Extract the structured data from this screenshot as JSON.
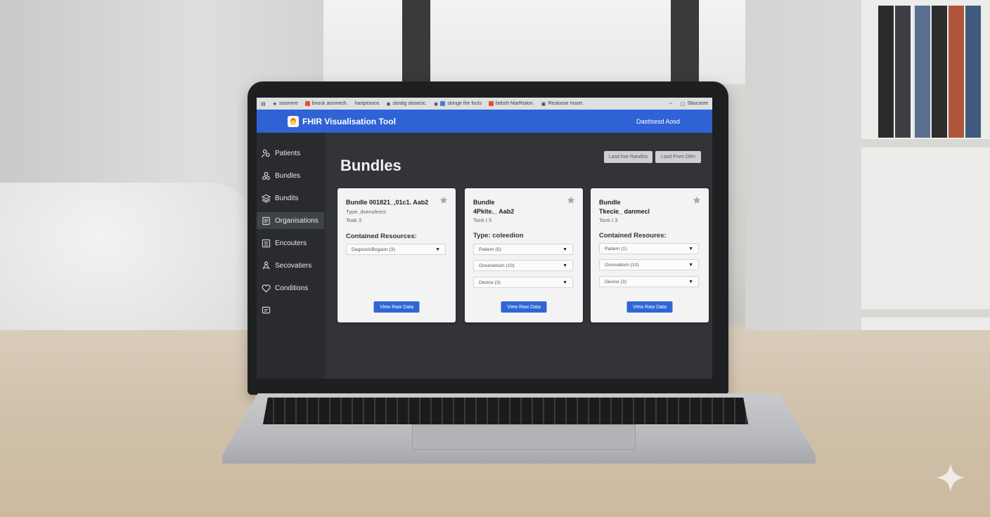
{
  "browser": {
    "tabs": [
      {
        "label": "sosmere",
        "color": "#777777"
      },
      {
        "label": "bnock aosmech.",
        "color": "#e0522b"
      },
      {
        "label": "hartpesoos",
        "color": "#dedfe1"
      },
      {
        "label": "slostig slosecic.",
        "color": "#555555"
      },
      {
        "label": "slonge the focls",
        "color": "#4a7bd8"
      },
      {
        "label": "bebsh MarRstion.",
        "color": "#e0522b"
      },
      {
        "label": "Resloose Insort.",
        "color": "#777777"
      }
    ],
    "right_label": "Sbocsnre"
  },
  "app": {
    "title": "FHIR Visualisation Tool",
    "header_link": "Dastlsesd  Aosd"
  },
  "sidebar": {
    "items": [
      {
        "label": "Patients",
        "icon": "people-icon"
      },
      {
        "label": "Bundles",
        "icon": "people-icon"
      },
      {
        "label": "Bundits",
        "icon": "layers-icon"
      },
      {
        "label": "Organisations",
        "icon": "document-icon",
        "active": true
      },
      {
        "label": "Encouters",
        "icon": "list-icon"
      },
      {
        "label": "Secovatiers",
        "icon": "network-icon"
      },
      {
        "label": "Conditions",
        "icon": "heart-icon"
      },
      {
        "label": "",
        "icon": "chat-icon"
      }
    ]
  },
  "main": {
    "title": "Bundles",
    "buttons": [
      "Lasd hse Randlss",
      "Lasd Fmm DRn"
    ],
    "cards": [
      {
        "title_lines": [
          "Bundle 001821_,01c1. Aab2"
        ],
        "type_text": "Type, dsensfeect",
        "total_text": "Toak 3",
        "heading": "Contained Resources:",
        "resources": [
          "DagoosisBogaon (3)"
        ],
        "button": "View Raw Data"
      },
      {
        "title_lines": [
          "Bundle",
          "4Pkite._ Aab2"
        ],
        "type_text": "",
        "total_text": "Tonk I 5",
        "heading": "Type: coleedion",
        "resources": [
          "Patiern (5)",
          "Oosenetiom (10)",
          "Device (3)"
        ],
        "button": "View Raw Data"
      },
      {
        "title_lines": [
          "Bundle",
          "Tkecie_ danmecl"
        ],
        "type_text": "",
        "total_text": "Tonk I 3",
        "heading": "Contained Resoures:",
        "resources": [
          "Patiern (1)",
          "Oosrvatiom (10)",
          "Device (3)"
        ],
        "button": "View Raw Data"
      }
    ]
  },
  "colors": {
    "appbar": "#2f62d4",
    "primary_button": "#2f66d6",
    "screen_bg": "#323438",
    "sidebar_bg": "#2a2b2e"
  }
}
